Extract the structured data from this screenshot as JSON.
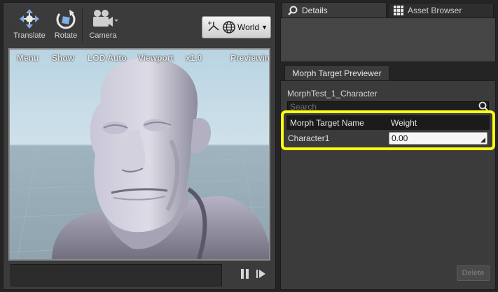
{
  "toolbar": {
    "translate_label": "Translate",
    "rotate_label": "Rotate",
    "camera_label": "Camera",
    "world_label": "World",
    "icons": [
      "translate-icon",
      "rotate-icon",
      "camera-icon",
      "coordinate-space-icon",
      "globe-icon"
    ]
  },
  "viewport": {
    "menu": [
      "Menu",
      "Show",
      "LOD Auto",
      "Viewport",
      "x1.0",
      "Previewin"
    ]
  },
  "tabs": {
    "details": "Details",
    "asset_browser": "Asset Browser",
    "morph_previewer": "Morph Target Previewer"
  },
  "morph": {
    "asset_name": "MorphTest_1_Character",
    "search_placeholder": "Search",
    "columns": [
      "Morph Target Name",
      "Weight"
    ],
    "rows": [
      {
        "name": "Character1",
        "weight": "0.00"
      }
    ],
    "delete_label": "Delete"
  },
  "colors": {
    "highlight": "#ffff14",
    "panel": "#3b3b3b",
    "background": "#242424"
  }
}
